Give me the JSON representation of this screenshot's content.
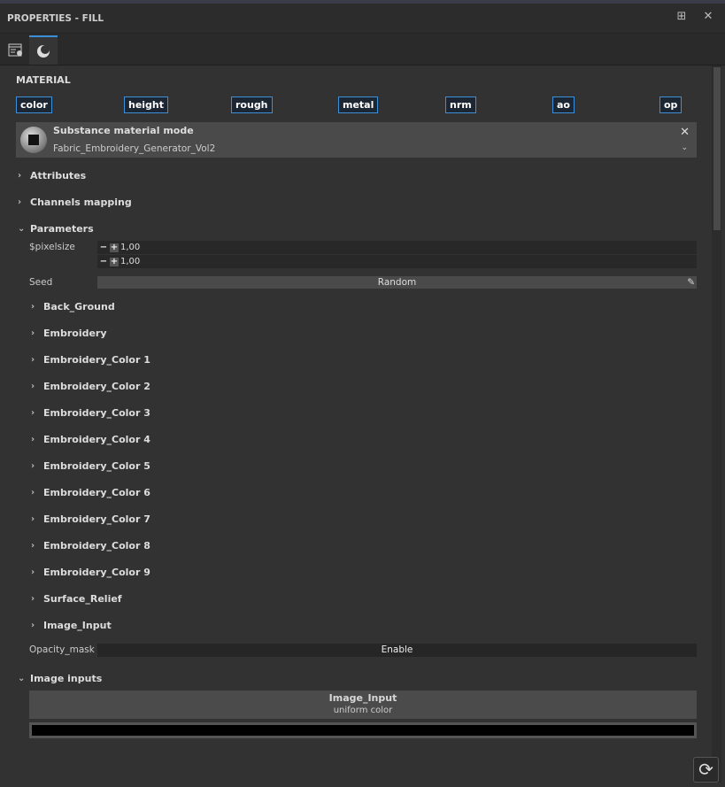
{
  "window": {
    "title": "PROPERTIES - FILL"
  },
  "material": {
    "section": "MATERIAL",
    "channels": [
      "color",
      "height",
      "rough",
      "metal",
      "nrm",
      "ao",
      "op"
    ],
    "mode_title": "Substance material mode",
    "name": "Fabric_Embroidery_Generator_Vol2"
  },
  "sections": {
    "attributes": "Attributes",
    "channels_mapping": "Channels mapping",
    "parameters": "Parameters",
    "image_inputs": "Image inputs"
  },
  "params": {
    "pixelsize_label": "$pixelsize",
    "pixelsize_x": "1,00",
    "pixelsize_y": "1,00",
    "seed_label": "Seed",
    "seed_value": "Random",
    "groups": [
      "Back_Ground",
      "Embroidery",
      "Embroidery_Color 1",
      "Embroidery_Color 2",
      "Embroidery_Color 3",
      "Embroidery_Color 4",
      "Embroidery_Color 5",
      "Embroidery_Color 6",
      "Embroidery_Color 7",
      "Embroidery_Color 8",
      "Embroidery_Color 9",
      "Surface_Relief",
      "Image_Input"
    ],
    "opacity_label": "Opacity_mask",
    "opacity_value": "Enable"
  },
  "image_input": {
    "title": "Image_Input",
    "subtitle": "uniform color",
    "color": "#000000"
  },
  "colors": {
    "accent": "#3d8fd8"
  }
}
